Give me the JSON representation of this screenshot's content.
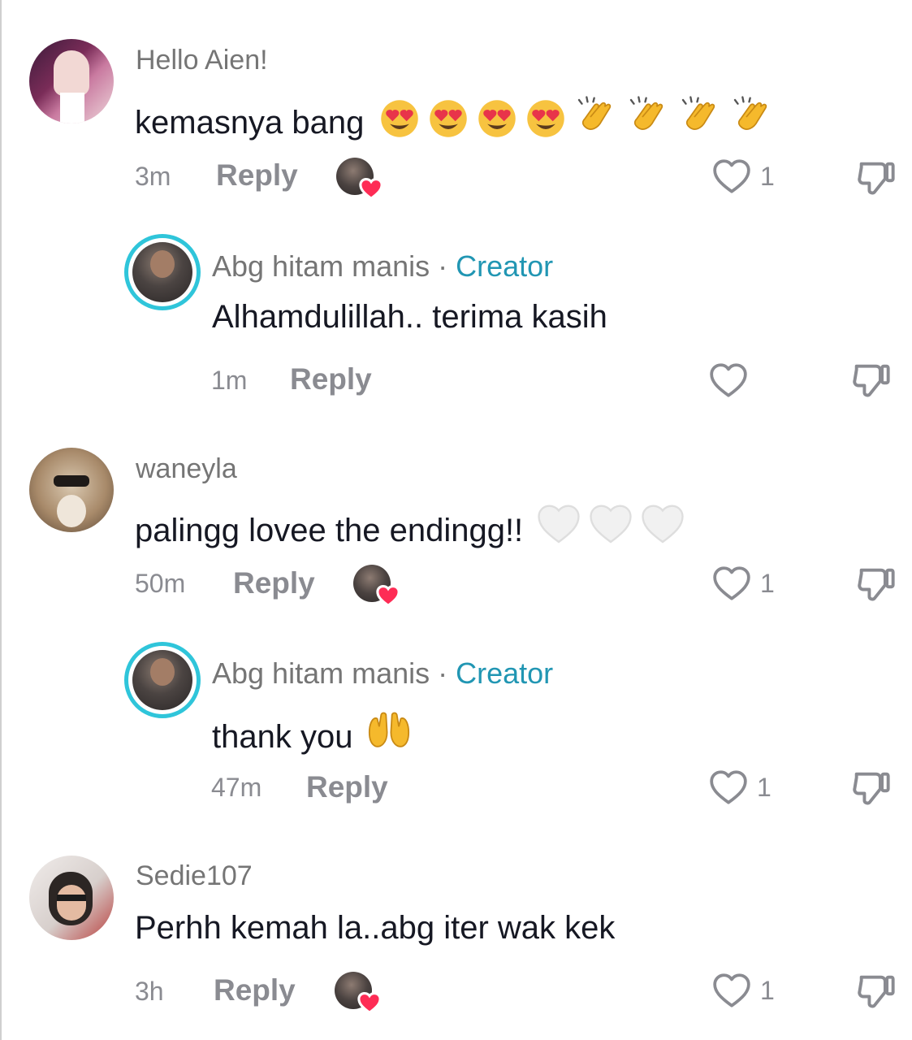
{
  "comments": [
    {
      "username": "Hello Aien!",
      "text": "kemasnya bang",
      "emojis": [
        "heart-eyes",
        "heart-eyes",
        "heart-eyes",
        "heart-eyes",
        "clap",
        "clap",
        "clap",
        "clap"
      ],
      "time": "3m",
      "reply_label": "Reply",
      "like_count": "1",
      "creator_liked": true
    },
    {
      "username": "Abg hitam manis",
      "separator": " · ",
      "creator_label": "Creator",
      "text": "Alhamdulillah.. terima kasih",
      "time": "1m",
      "reply_label": "Reply",
      "like_count": ""
    },
    {
      "username": "waneyla",
      "text": "palingg lovee the endingg!!",
      "emojis": [
        "white-heart",
        "white-heart",
        "white-heart"
      ],
      "time": "50m",
      "reply_label": "Reply",
      "like_count": "1",
      "creator_liked": true
    },
    {
      "username": "Abg hitam manis",
      "separator": " · ",
      "creator_label": "Creator",
      "text": "thank you",
      "emojis": [
        "palms-up"
      ],
      "time": "47m",
      "reply_label": "Reply",
      "like_count": "1"
    },
    {
      "username": "Sedie107",
      "text": "Perhh kemah la..abg iter wak kek",
      "time": "3h",
      "reply_label": "Reply",
      "like_count": "1",
      "creator_liked": true
    }
  ],
  "colors": {
    "creator_accent": "#2196b3",
    "ring": "#2fc5da",
    "muted": "#8a8b91",
    "text": "#161823",
    "heart_red": "#fe2c55"
  }
}
